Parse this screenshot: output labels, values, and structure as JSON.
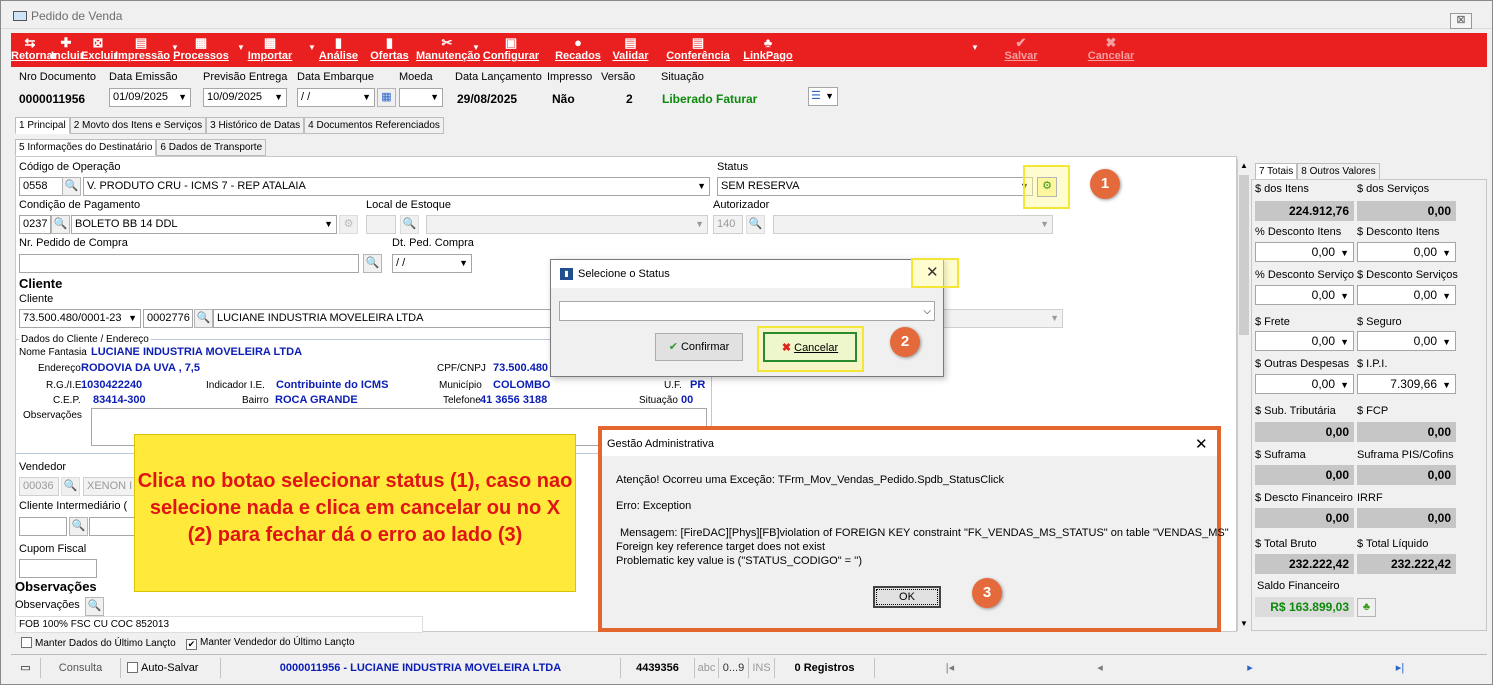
{
  "window": {
    "title": "Pedido de Venda",
    "close_symbol": "⊠"
  },
  "toolbar": {
    "buttons": [
      {
        "label": "Retornar",
        "icon": "⇆"
      },
      {
        "label": "Incluir",
        "icon": "✚"
      },
      {
        "label": "Excluir",
        "icon": "⊠"
      },
      {
        "label": "Impressão",
        "icon": "▤"
      },
      {
        "label": "Processos",
        "icon": "▦"
      },
      {
        "label": "Importar",
        "icon": "▦"
      },
      {
        "label": "Análise",
        "icon": "▮"
      },
      {
        "label": "Ofertas",
        "icon": "▮"
      },
      {
        "label": "Manutenção",
        "icon": "✂"
      },
      {
        "label": "Configurar",
        "icon": "▣"
      },
      {
        "label": "Recados",
        "icon": "●"
      },
      {
        "label": "Validar",
        "icon": "▤"
      },
      {
        "label": "Conferência",
        "icon": "▤"
      },
      {
        "label": "LinkPago",
        "icon": "♣"
      },
      {
        "label": "Salvar",
        "icon": "✔"
      },
      {
        "label": "Cancelar",
        "icon": "✖"
      }
    ]
  },
  "header": {
    "nro_documento_label": "Nro Documento",
    "nro_documento": "0000011956",
    "data_emissao_label": "Data Emissão",
    "data_emissao": "01/09/2025",
    "previsao_entrega_label": "Previsão Entrega",
    "previsao_entrega": "10/09/2025",
    "data_embarque_label": "Data Embarque",
    "data_embarque": "/ /",
    "moeda_label": "Moeda",
    "moeda": "",
    "data_lancamento_label": "Data Lançamento",
    "data_lancamento": "29/08/2025",
    "impresso_label": "Impresso",
    "impresso": "Não",
    "versao_label": "Versão",
    "versao": "2",
    "situacao_label": "Situação",
    "situacao": "Liberado Faturar"
  },
  "tabs_top": [
    "1 Principal",
    "2 Movto dos Itens e Serviços",
    "3 Histórico de Datas",
    "4 Documentos Referenciados"
  ],
  "tabs_second": [
    "5 Informações do Destinatário",
    "6 Dados de Transporte"
  ],
  "form": {
    "codigo_operacao_label": "Código de Operação",
    "codigo_operacao_code": "0558",
    "codigo_operacao_desc": "V. PRODUTO CRU - ICMS 7 - REP ATALAIA",
    "status_label": "Status",
    "status_value": "SEM RESERVA",
    "condicao_pagamento_label": "Condição de Pagamento",
    "condicao_pagamento_code": "0237",
    "condicao_pagamento_desc": "BOLETO BB 14 DDL",
    "local_estoque_label": "Local de Estoque",
    "autorizador_label": "Autorizador",
    "autorizador_code": "140",
    "nr_pedido_compra_label": "Nr. Pedido de Compra",
    "nr_pedido_compra": "",
    "dt_ped_compra_label": "Dt. Ped. Compra",
    "dt_ped_compra": "/ /",
    "cliente_section": "Cliente",
    "cliente_label": "Cliente",
    "cliente_cnpj": "73.500.480/0001-23",
    "cliente_code": "0002776",
    "cliente_nome": "LUCIANE INDUSTRIA MOVELEIRA LTDA",
    "dados_cliente_legend": "Dados do Cliente / Endereço",
    "nome_fantasia_label": "Nome Fantasia",
    "nome_fantasia": "LUCIANE INDUSTRIA MOVELEIRA LTDA",
    "endereco_label": "Endereço",
    "endereco": "RODOVIA DA UVA , 7,5",
    "cpf_cnpj_label": "CPF/CNPJ",
    "cpf_cnpj": "73.500.480",
    "rg_ie_label": "R.G./I.E.",
    "rg_ie": "1030422240",
    "indicador_ie_label": "Indicador I.E.",
    "indicador_ie": "Contribuinte do ICMS",
    "municipio_label": "Município",
    "municipio": "COLOMBO",
    "uf_label": "U.F.",
    "uf": "PR",
    "cep_label": "C.E.P.",
    "cep": "83414-300",
    "bairro_label": "Bairro",
    "bairro": "ROCA GRANDE",
    "telefone_label": "Telefone",
    "telefone": "41  3656 3188",
    "situacao_label": "Situação",
    "situacao": "00",
    "observacoes_label": "Observações",
    "vendedor_label": "Vendedor",
    "vendedor_code": "00036",
    "vendedor_nome": "XENON I",
    "cliente_intermediario_label": "Cliente Intermediário (",
    "cupom_fiscal_label": "Cupom Fiscal",
    "observacoes_section": "Observações",
    "observacoes_label2": "Observações",
    "observacoes_text": "FOB 100% FSC CU COC 852013",
    "manter_dados_label": "Manter Dados do Último Lançto",
    "manter_vendedor_label": "Manter Vendedor do Último Lançto"
  },
  "select_status_dialog": {
    "title": "Selecione o Status",
    "value": "",
    "confirm_label": "Confirmar",
    "cancel_label": "Cancelar",
    "close_symbol": "✕"
  },
  "error_dialog": {
    "title": "Gestão Administrativa",
    "close_symbol": "✕",
    "line1": "Atenção! Ocorreu uma Exceção: TFrm_Mov_Vendas_Pedido.Spdb_StatusClick",
    "line2": "Erro: Exception",
    "line3": "Mensagem: [FireDAC][Phys][FB]violation of FOREIGN KEY constraint \"FK_VENDAS_MS_STATUS\" on table \"VENDAS_MS\"",
    "line4": "Foreign key reference target does not exist",
    "line5": "Problematic key value is (\"STATUS_CODIGO\" = '')",
    "ok_label": "OK"
  },
  "annotation": {
    "text": "Clica no botao selecionar status (1), caso nao selecione nada e clica em cancelar ou no X (2) para fechar dá o erro ao lado (3)",
    "badges": [
      "1",
      "2",
      "3"
    ]
  },
  "totals": {
    "tabs": [
      "7 Totais",
      "8 Outros Valores"
    ],
    "dos_itens_label": "$ dos Itens",
    "dos_itens": "224.912,76",
    "dos_servicos_label": "$ dos Serviços",
    "dos_servicos": "0,00",
    "pct_desc_itens_label": "% Desconto Itens",
    "pct_desc_itens": "0,00",
    "desc_itens_label": "$ Desconto Itens",
    "desc_itens": "0,00",
    "pct_desc_serv_label": "% Desconto Serviço:",
    "pct_desc_serv": "0,00",
    "desc_serv_label": "$ Desconto Serviços",
    "desc_serv": "0,00",
    "frete_label": "$ Frete",
    "frete": "0,00",
    "seguro_label": "$ Seguro",
    "seguro": "0,00",
    "outras_desp_label": "$ Outras Despesas",
    "outras_desp": "0,00",
    "ipi_label": "$ I.P.I.",
    "ipi": "7.309,66",
    "sub_trib_label": "$ Sub. Tributária",
    "sub_trib": "0,00",
    "fcp_label": "$ FCP",
    "fcp": "0,00",
    "suframa_label": "$ Suframa",
    "suframa": "0,00",
    "suframa_pis_label": "Suframa PIS/Cofins",
    "suframa_pis": "0,00",
    "desc_fin_label": "$ Descto Financeiro",
    "desc_fin": "0,00",
    "irrf_label": "IRRF",
    "irrf": "0,00",
    "total_bruto_label": "$ Total Bruto",
    "total_bruto": "232.222,42",
    "total_liquido_label": "$ Total Líquido",
    "total_liquido": "232.222,42",
    "saldo_fin_label": "Saldo Financeiro",
    "saldo_fin": "R$ 163.899,03"
  },
  "statusbar": {
    "consulta": "Consulta",
    "auto_salvar": "Auto-Salvar",
    "documento": "0000011956 - LUCIANE INDUSTRIA MOVELEIRA LTDA",
    "codigo": "4439356",
    "abc": "abc",
    "range": "0...9",
    "ins": "INS",
    "registros": "0 Registros"
  }
}
